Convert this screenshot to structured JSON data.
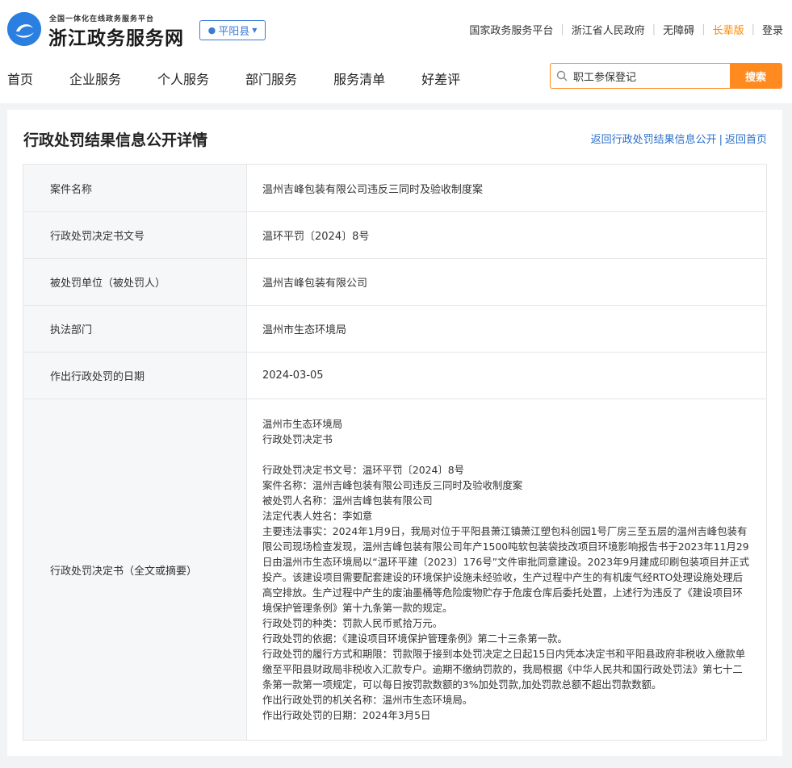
{
  "header": {
    "slogan": "全国一体化在线政务服务平台",
    "site_name": "浙江政务服务网",
    "region": "平阳县",
    "top_links": [
      "国家政务服务平台",
      "浙江省人民政府",
      "无障碍",
      "长辈版",
      "登录"
    ]
  },
  "nav": {
    "items": [
      "首页",
      "企业服务",
      "个人服务",
      "部门服务",
      "服务清单",
      "好差评"
    ]
  },
  "search": {
    "value": "职工参保登记",
    "button": "搜索"
  },
  "page": {
    "title": "行政处罚结果信息公开详情",
    "back_list": "返回行政处罚结果信息公开",
    "back_home": "返回首页"
  },
  "detail": {
    "case_name_label": "案件名称",
    "case_name": "温州吉峰包装有限公司违反三同时及验收制度案",
    "doc_no_label": "行政处罚决定书文号",
    "doc_no": "温环平罚〔2024〕8号",
    "party_label": "被处罚单位（被处罚人）",
    "party": "温州吉峰包装有限公司",
    "dept_label": "执法部门",
    "dept": "温州市生态环境局",
    "date_label": "作出行政处罚的日期",
    "date": "2024-03-05",
    "decision_label": "行政处罚决定书（全文或摘要）"
  },
  "decision": {
    "line1": "温州市生态环境局",
    "line2": "行政处罚决定书",
    "doc_no": "行政处罚决定书文号：温环平罚〔2024〕8号",
    "case_name": "案件名称：温州吉峰包装有限公司违反三同时及验收制度案",
    "party": "被处罚人名称：温州吉峰包装有限公司",
    "legal_rep": "法定代表人姓名：李如意",
    "facts": "主要违法事实：2024年1月9日，我局对位于平阳县萧江镇萧江塑包科创园1号厂房三至五层的温州吉峰包装有限公司现场检查发现，温州吉峰包装有限公司年产1500吨软包装袋技改项目环境影响报告书于2023年11月29日由温州市生态环境局以“温环平建〔2023〕176号”文件审批同意建设。2023年9月建成印刷包装项目并正式投产。该建设项目需要配套建设的环境保护设施未经验收，生产过程中产生的有机废气经RTO处理设施处理后高空排放。生产过程中产生的废油墨桶等危险废物贮存于危废仓库后委托处置，上述行为违反了《建设项目环境保护管理条例》第十九条第一款的规定。",
    "type": "行政处罚的种类：罚款人民币贰拾万元。",
    "basis": "行政处罚的依据：《建设项目环境保护管理条例》第二十三条第一款。",
    "performance": "行政处罚的履行方式和期限：罚款限于接到本处罚决定之日起15日内凭本决定书和平阳县政府非税收入缴款单缴至平阳县财政局非税收入汇款专户。逾期不缴纳罚款的，我局根据《中华人民共和国行政处罚法》第七十二条第一款第一项规定，可以每日按罚款数额的3%加处罚款,加处罚款总额不超出罚款数额。",
    "authority": "作出行政处罚的机关名称：温州市生态环境局。",
    "date": "作出行政处罚的日期：2024年3月5日"
  }
}
